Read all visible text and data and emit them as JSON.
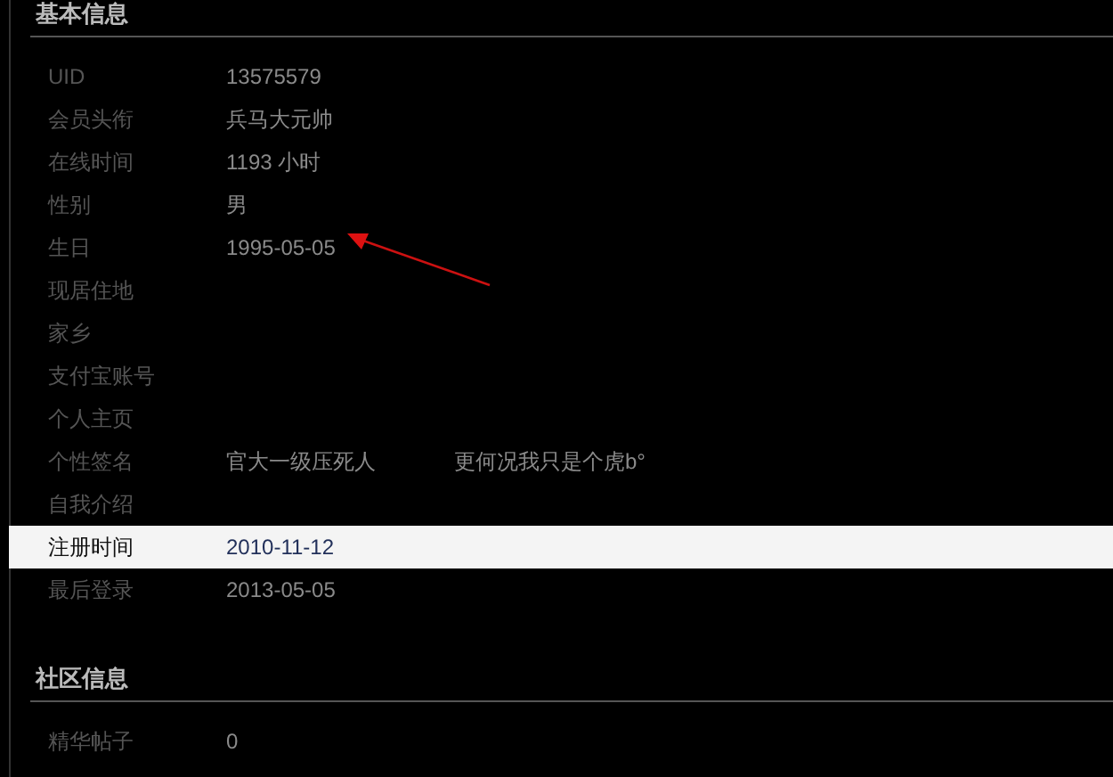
{
  "sections": [
    {
      "title": "基本信息",
      "rows": [
        {
          "label": "UID",
          "value": "13575579",
          "selected": false
        },
        {
          "label": "会员头衔",
          "value": "兵马大元帅",
          "selected": false
        },
        {
          "label": "在线时间",
          "value": "1193 小时",
          "selected": false
        },
        {
          "label": "性别",
          "value": "男",
          "selected": false
        },
        {
          "label": "生日",
          "value": "1995-05-05",
          "selected": false,
          "annotated": true
        },
        {
          "label": "现居住地",
          "selected": false
        },
        {
          "label": "家乡",
          "selected": false
        },
        {
          "label": "支付宝账号",
          "selected": false
        },
        {
          "label": "个人主页",
          "selected": false
        },
        {
          "label": "个性签名",
          "value": "官大一级压死人",
          "value_2": "更何况我只是个虎b°",
          "selected": false
        },
        {
          "label": "自我介绍",
          "selected": false
        },
        {
          "label": "注册时间",
          "value": "2010-11-12",
          "selected": true
        },
        {
          "label": "最后登录",
          "value": "2013-05-05",
          "selected": false
        }
      ]
    },
    {
      "title": "社区信息",
      "rows": [
        {
          "label": "精华帖子",
          "value": "0",
          "selected": false
        }
      ]
    }
  ]
}
